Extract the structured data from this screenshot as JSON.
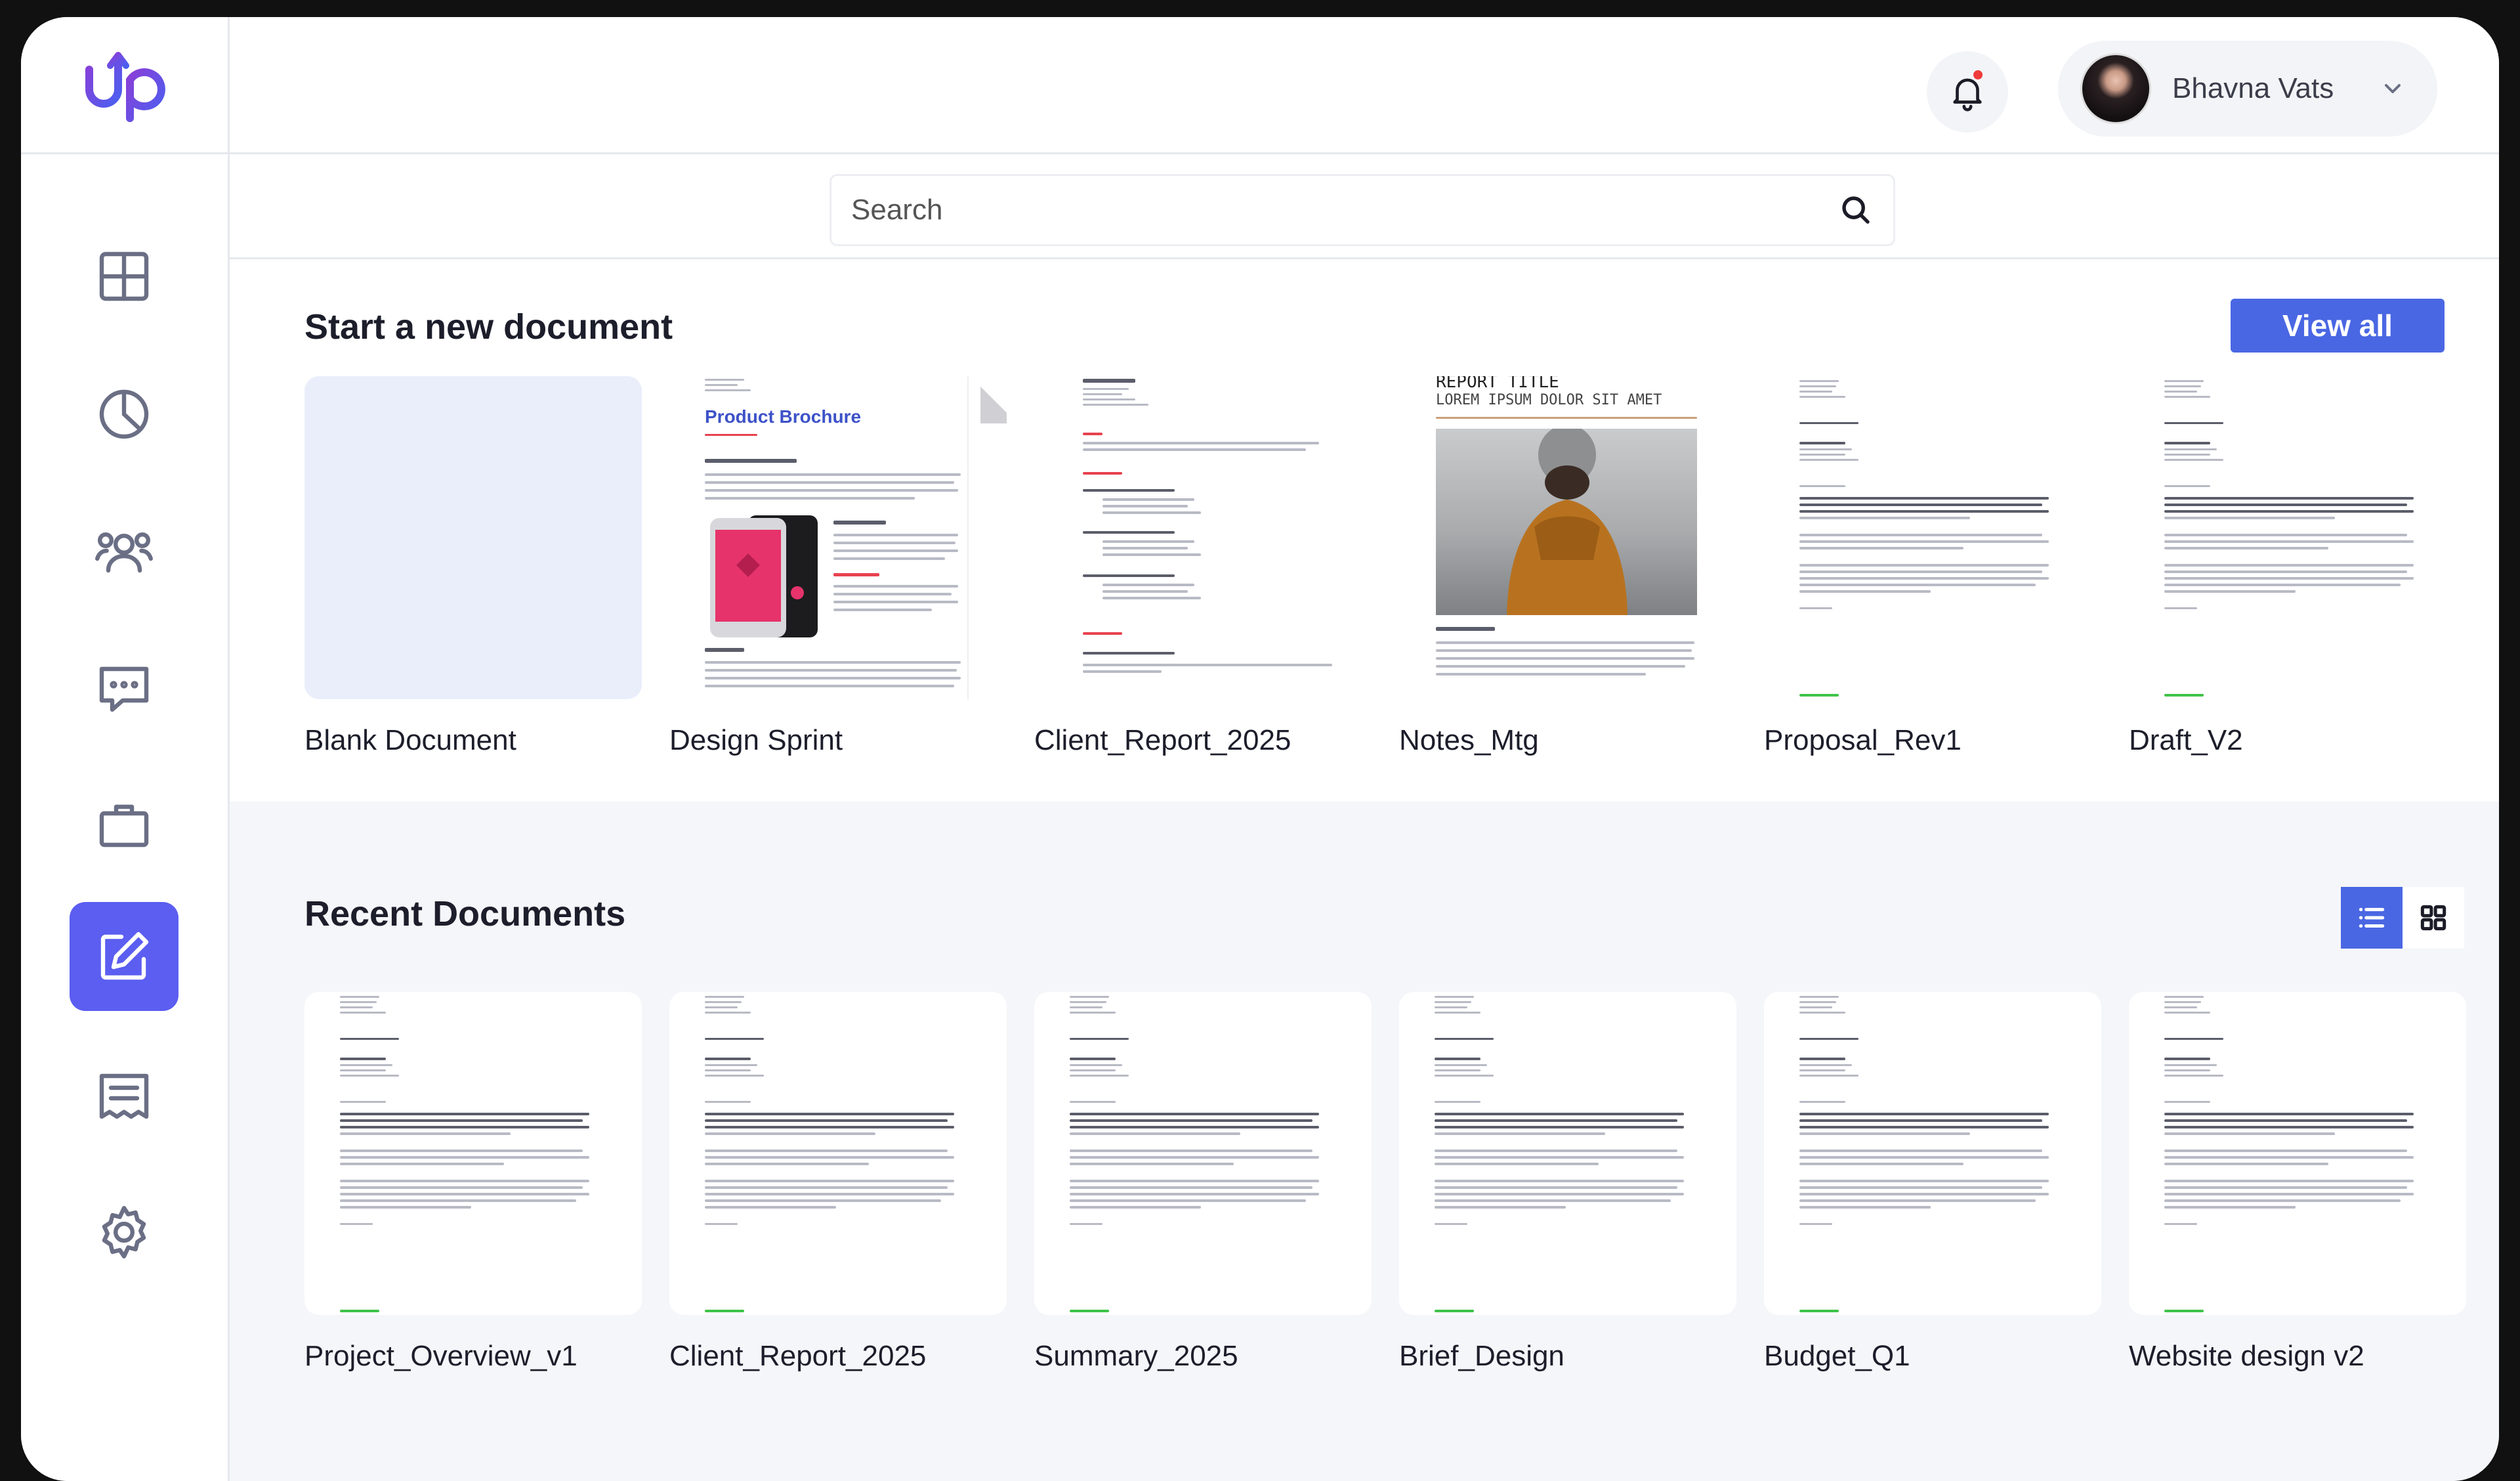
{
  "app": {
    "logo_text": "up"
  },
  "header": {
    "user_name": "Bhavna Vats"
  },
  "search": {
    "placeholder": "Search"
  },
  "new_document": {
    "title": "Start a new document",
    "view_all_label": "View all",
    "templates": [
      {
        "label": "Blank Document"
      },
      {
        "label": "Design Sprint",
        "preview_heading": "Product Brochure"
      },
      {
        "label": "Client_Report_2025"
      },
      {
        "label": "Notes_Mtg",
        "preview_heading": "REPORT TITLE",
        "preview_sub": "LOREM IPSUM DOLOR SIT AMET"
      },
      {
        "label": "Proposal_Rev1"
      },
      {
        "label": "Draft_V2"
      }
    ]
  },
  "recent": {
    "title": "Recent Documents",
    "view_mode": "list",
    "documents": [
      {
        "label": "Project_Overview_v1"
      },
      {
        "label": "Client_Report_2025"
      },
      {
        "label": "Summary_2025"
      },
      {
        "label": "Brief_Design"
      },
      {
        "label": "Budget_Q1"
      },
      {
        "label": "Website design v2"
      }
    ]
  },
  "sidebar": {
    "items": [
      {
        "icon": "grid-icon"
      },
      {
        "icon": "pie-chart-icon"
      },
      {
        "icon": "users-icon"
      },
      {
        "icon": "chat-icon"
      },
      {
        "icon": "briefcase-icon"
      },
      {
        "icon": "edit-icon",
        "active": true
      },
      {
        "icon": "document-list-icon"
      },
      {
        "icon": "gear-icon"
      }
    ]
  },
  "colors": {
    "accent": "#5b5ef0",
    "button": "#4a67e3",
    "notification": "#ef3b3b",
    "logo_gradient": [
      "#8a3fd8",
      "#4a5ff0"
    ]
  }
}
